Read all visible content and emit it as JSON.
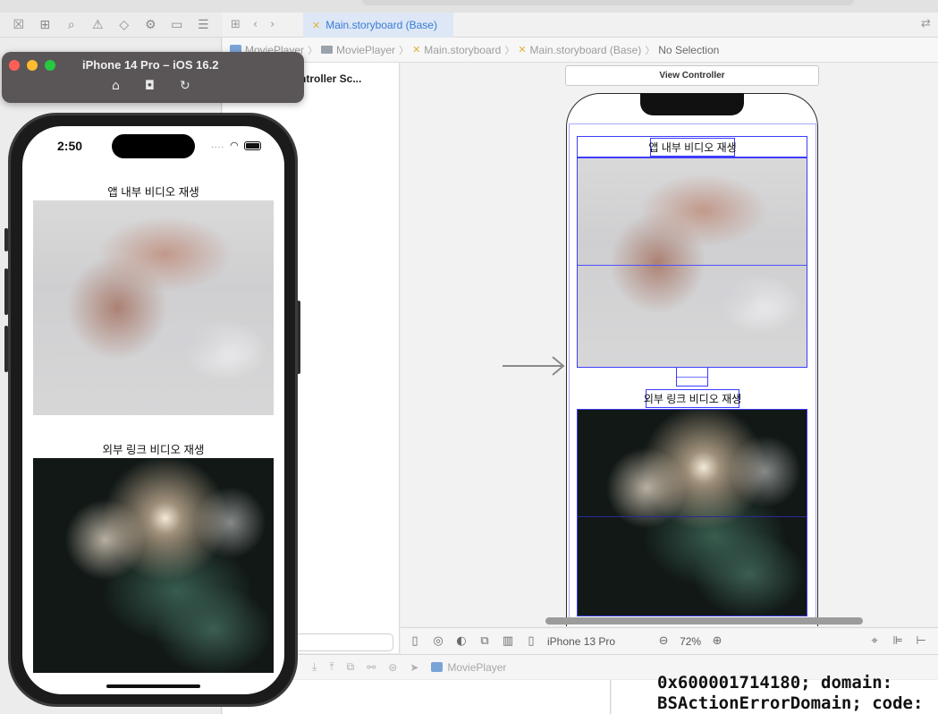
{
  "simulator": {
    "title": "iPhone 14 Pro – iOS 16.2",
    "tool_icons": [
      "home-icon",
      "screenshot-icon",
      "rotate-icon"
    ],
    "status_time": "2:50",
    "status_dots": "....",
    "app": {
      "title1": "앱 내부 비디오 재생",
      "title2": "외부 링크 비디오 재생"
    }
  },
  "tabs": {
    "main": "Main.storyboard (Base)"
  },
  "breadcrumb": [
    "MoviePlayer",
    "MoviePlayer",
    "Main.storyboard",
    "Main.storyboard (Base)",
    "No Selection"
  ],
  "outline": {
    "scene_label": "ntroller Sc..."
  },
  "canvas": {
    "vc_title": "View Controller",
    "label1": "앱 내부 비디오 재생",
    "label2": "외부 링크 비디오 재생"
  },
  "canvas_bar": {
    "device": "iPhone 13 Pro",
    "zoom": "72%"
  },
  "debug_bar": {
    "target": "MoviePlayer"
  },
  "console": {
    "text": "0x600001714180; domain:\nBSActionErrorDomain; code:"
  },
  "colors": {
    "selection_blue": "#3c3cff",
    "tab_active_text": "#3a7bd5"
  }
}
